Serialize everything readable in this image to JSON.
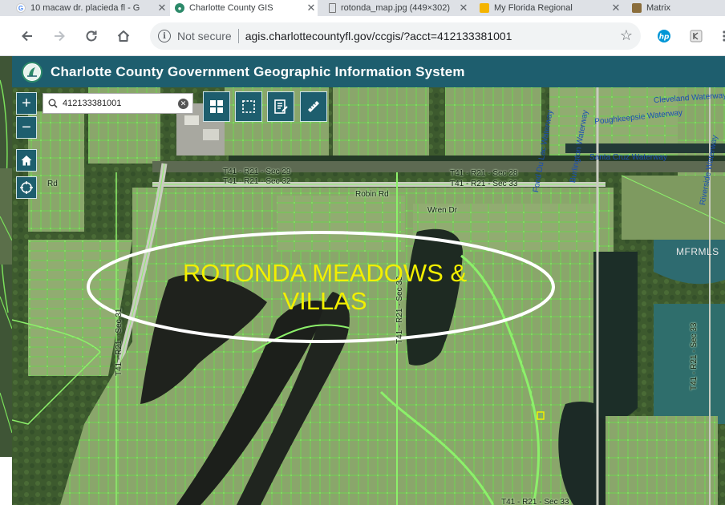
{
  "browser": {
    "tabs": [
      {
        "title": "10 macaw dr. placieda fl - G",
        "icon": "google-icon"
      },
      {
        "title": "Charlotte County GIS",
        "icon": "county-seal-icon"
      },
      {
        "title": "rotonda_map.jpg (449×302)",
        "icon": "page-icon"
      },
      {
        "title": "My Florida Regional",
        "icon": "mfr-icon"
      },
      {
        "title": "Matrix",
        "icon": "matrix-icon"
      }
    ],
    "address": {
      "security": "Not secure",
      "url": "agis.charlottecountyfl.gov/ccgis/?acct=412133381001"
    }
  },
  "app": {
    "title": "Charlotte County Government Geographic Information System"
  },
  "map": {
    "search": {
      "value": "412133381001"
    },
    "controls": {
      "zoom_in": "+",
      "zoom_out": "−"
    },
    "labels": {
      "section_29": "T41 - R21 - Sec 29",
      "section_32_top": "T41 - R21 - Sec 32",
      "section_28": "T41 - R21 - Sec 28",
      "section_33_top": "T41 - R21 - Sec 33",
      "section_33_right": "T41 - R21 - Sec 33",
      "section_31": "T41 - R21 - Sec 31",
      "section_33_mid": "T41 - R21 - Sec 33",
      "section_33_bottom": "T41 - R21 - Sec 33",
      "robin_rd": "Robin Rd",
      "wren_dr": "Wren Dr",
      "left_rd": "Rd",
      "poughkeepsie": "Poughkeepsie Waterway",
      "santa_cruz": "Santa Cruz Waterway",
      "riverside": "Riverside Waterway",
      "fond_du_lac": "Fond Du Lac Waterway",
      "burlington": "Burlington Waterway",
      "cleveland_waterway": "Cleveland Waterway"
    },
    "overlay": {
      "line1": "ROTONDA MEADOWS &",
      "line2": "VILLAS",
      "color": "#f2ef00"
    },
    "watermark": "MFRMLS"
  }
}
